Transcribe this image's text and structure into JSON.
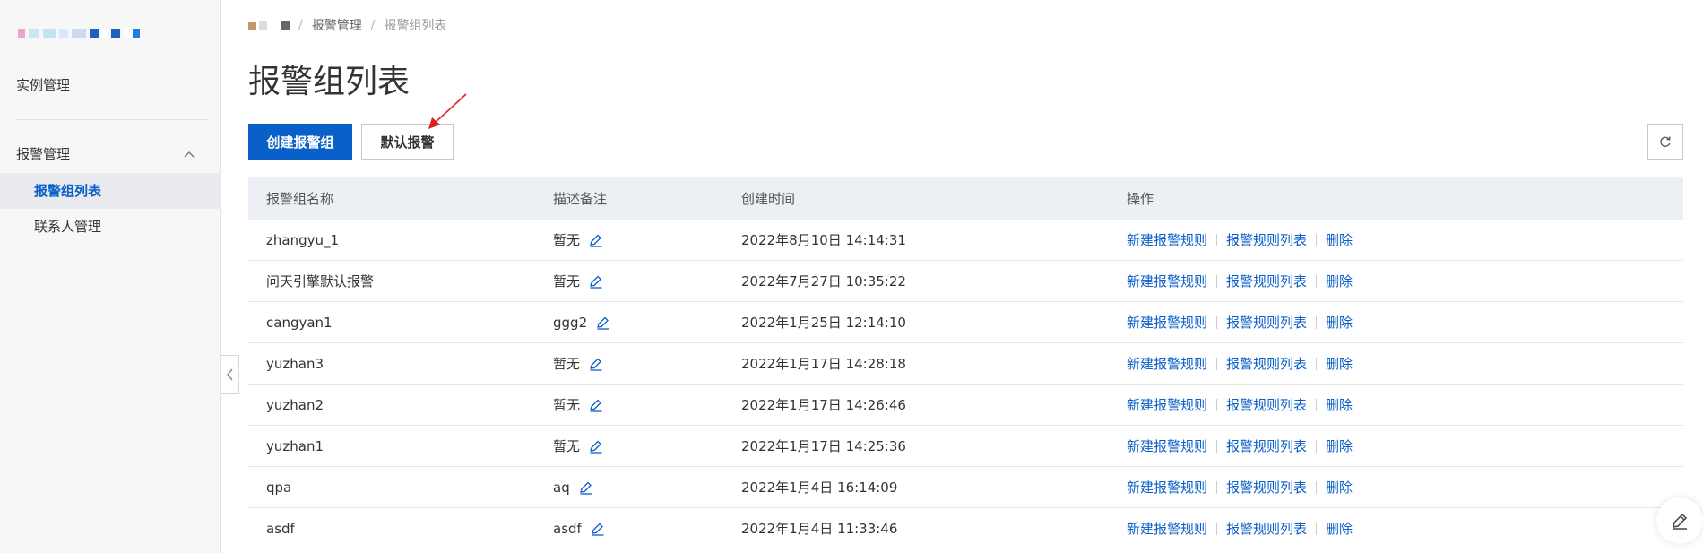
{
  "sidebar": {
    "instance_mgmt": "实例管理",
    "alarm_mgmt": "报警管理",
    "items": [
      {
        "label": "报警组列表"
      },
      {
        "label": "联系人管理"
      }
    ]
  },
  "breadcrumb": {
    "level1": "报警管理",
    "level2": "报警组列表"
  },
  "page_title": "报警组列表",
  "toolbar": {
    "create_label": "创建报警组",
    "default_label": "默认报警"
  },
  "table": {
    "headers": [
      "报警组名称",
      "描述备注",
      "创建时间",
      "操作"
    ],
    "rows": [
      {
        "name": "zhangyu_1",
        "desc": "暂无",
        "time": "2022年8月10日 14:14:31"
      },
      {
        "name": "问天引擎默认报警",
        "desc": "暂无",
        "time": "2022年7月27日 10:35:22"
      },
      {
        "name": "cangyan1",
        "desc": "ggg2",
        "time": "2022年1月25日 12:14:10"
      },
      {
        "name": "yuzhan3",
        "desc": "暂无",
        "time": "2022年1月17日 14:28:18"
      },
      {
        "name": "yuzhan2",
        "desc": "暂无",
        "time": "2022年1月17日 14:26:46"
      },
      {
        "name": "yuzhan1",
        "desc": "暂无",
        "time": "2022年1月17日 14:25:36"
      },
      {
        "name": "qpa",
        "desc": "aq",
        "time": "2022年1月4日 16:14:09"
      },
      {
        "name": "asdf",
        "desc": "asdf",
        "time": "2022年1月4日 11:33:46"
      }
    ],
    "ops": {
      "new_rule": "新建报警规则",
      "rule_list": "报警规则列表",
      "delete": "删除"
    }
  },
  "colors": {
    "primary": "#0a5fc8",
    "annotation_arrow": "#e02020"
  }
}
